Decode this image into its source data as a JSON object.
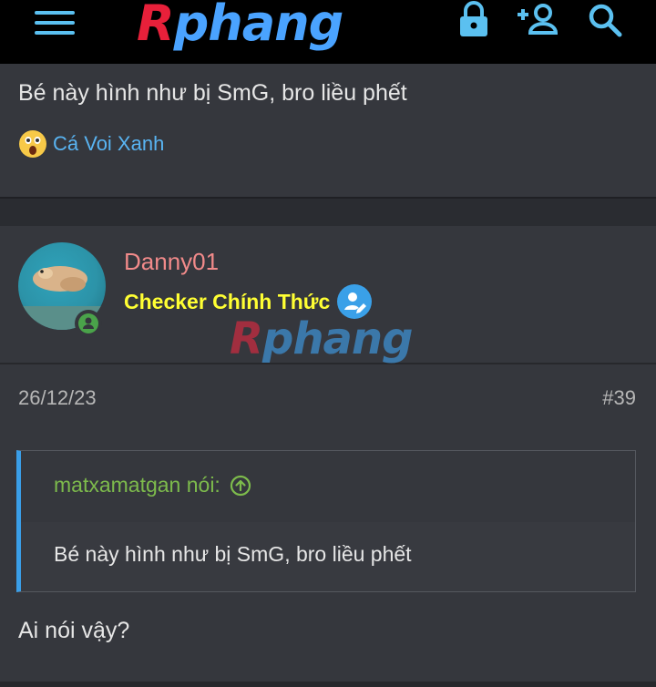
{
  "header": {
    "logo_part1": "R",
    "logo_part2": "phang",
    "menu_icon": "hamburger-icon",
    "lock_icon": "lock-icon",
    "register_icon": "add-user-icon",
    "search_icon": "search-icon",
    "accent": "#5bc0f0"
  },
  "post1": {
    "text": "Bé này hình như bị SmG, bro liều phết",
    "reaction": {
      "emoji": "wow-emoji-icon",
      "user": "Cá Voi Xanh"
    }
  },
  "post2": {
    "username": "Danny01",
    "user_title": "Checker Chính Thức",
    "badge_icon": "verified-checker-icon",
    "watermark_part1": "R",
    "watermark_part2": "phang",
    "date": "26/12/23",
    "number": "#39",
    "quote": {
      "author": "matxamatgan nói:",
      "text": "Bé này hình như bị SmG, bro liều phết"
    },
    "reply": "Ai nói vậy?"
  },
  "colors": {
    "background": "#2a2c31",
    "panel": "#35373d",
    "username": "#f18a8a",
    "user_title": "#ffff33",
    "link": "#59b4f2",
    "quote_author": "#7dbb4c",
    "online": "#4aa34a"
  }
}
